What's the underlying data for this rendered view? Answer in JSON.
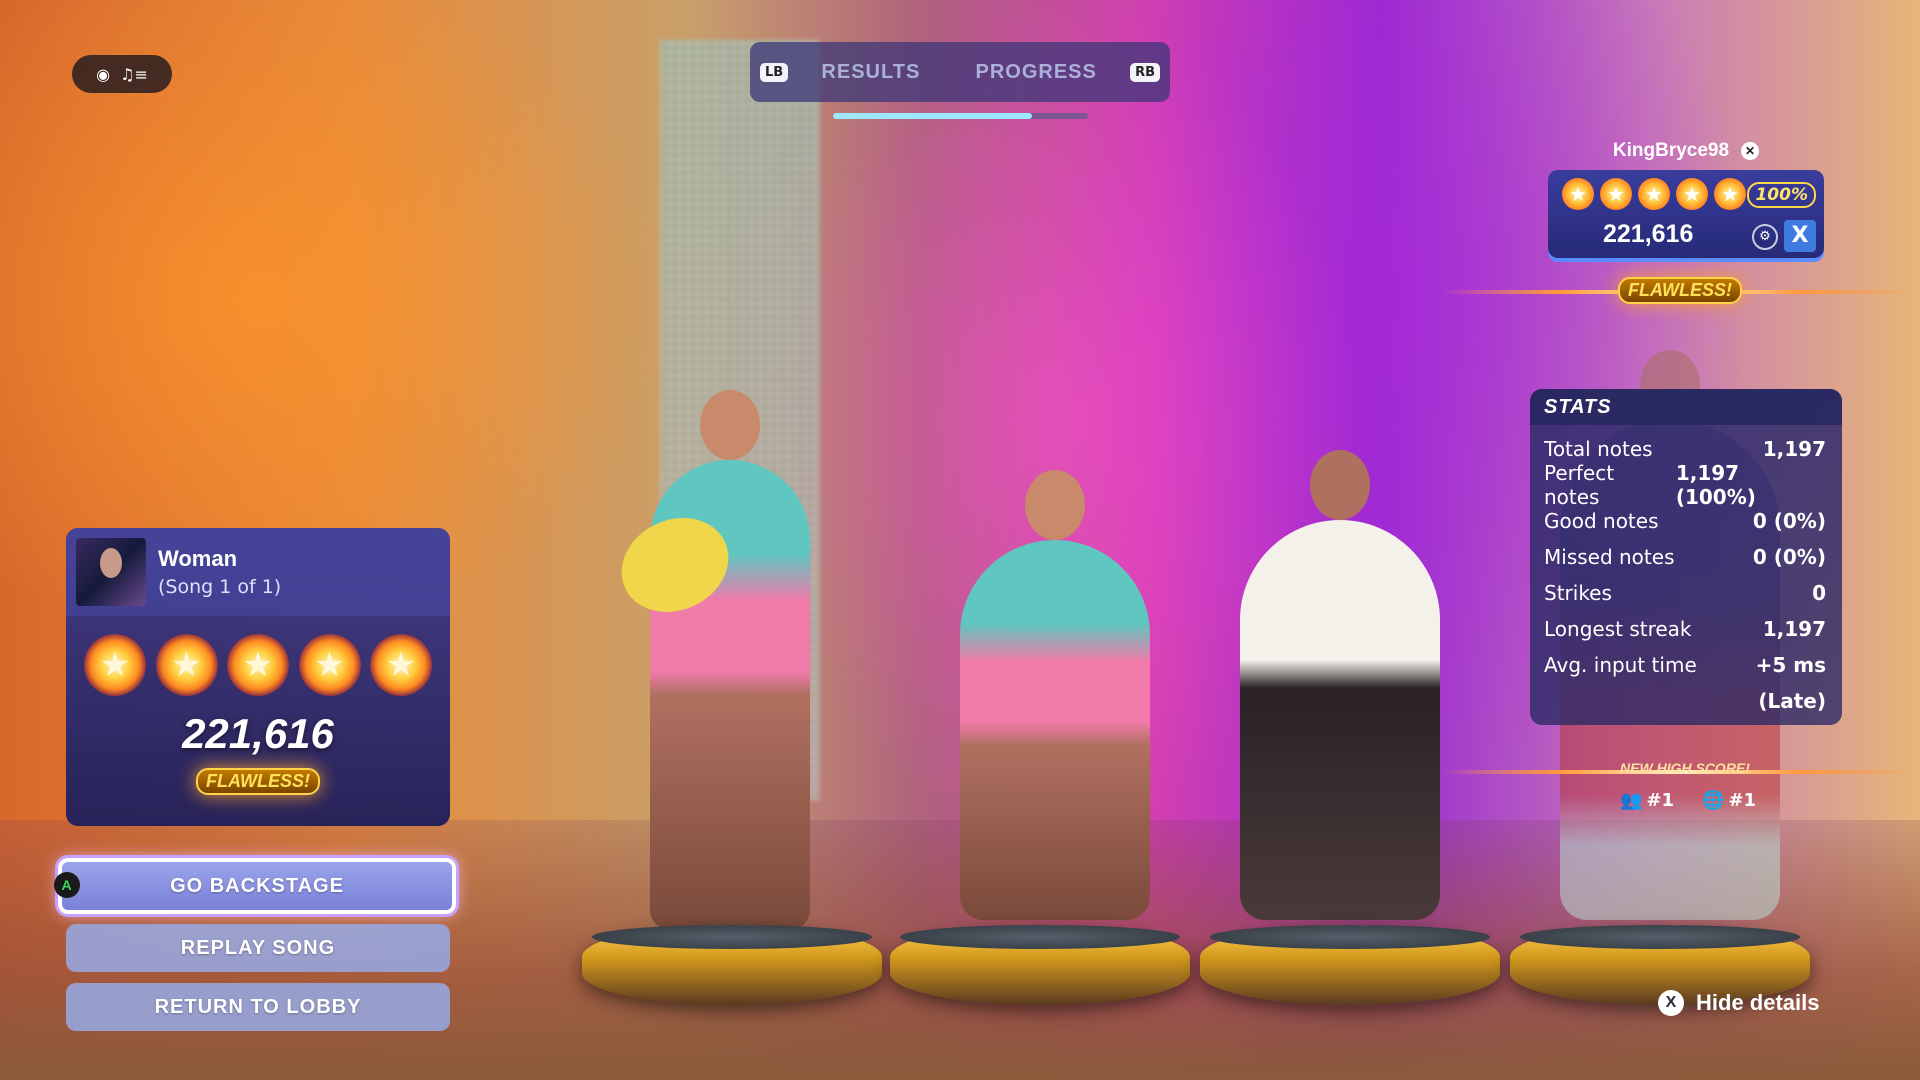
{
  "top_chip": {
    "icons": [
      "party-icon",
      "music-note-list-icon"
    ]
  },
  "tabs": {
    "left_key": "LB",
    "right_key": "RB",
    "items": [
      "RESULTS",
      "PROGRESS"
    ],
    "active_progress": 0.78
  },
  "player": {
    "name": "KingBryce98",
    "platform_icon": "xbox-icon",
    "stars": 5,
    "accuracy": "100%",
    "score": "221,616",
    "instrument_icon": "instrument-icon",
    "button_key": "X",
    "badge": "FLAWLESS!"
  },
  "song": {
    "title": "Woman",
    "subtitle": "(Song 1 of 1)",
    "stars": 5,
    "score": "221,616",
    "badge": "FLAWLESS!"
  },
  "menu": {
    "a_key": "A",
    "go_backstage": "GO BACKSTAGE",
    "replay_song": "REPLAY SONG",
    "return_to_lobby": "RETURN TO LOBBY"
  },
  "stats": {
    "title": "STATS",
    "rows": [
      {
        "label": "Total notes",
        "value": "1,197"
      },
      {
        "label": "Perfect notes",
        "value": "1,197 (100%)"
      },
      {
        "label": "Good notes",
        "value": "0 (0%)"
      },
      {
        "label": "Missed notes",
        "value": "0 (0%)"
      },
      {
        "label": "Strikes",
        "value": "0"
      },
      {
        "label": "Longest streak",
        "value": "1,197"
      },
      {
        "label": "Avg. input time",
        "value": "+5 ms"
      },
      {
        "label": "",
        "value": "(Late)"
      }
    ]
  },
  "high_score": {
    "label": "NEW HIGH SCORE!",
    "friends_rank": "#1",
    "global_rank": "#1"
  },
  "hide_details": {
    "key": "X",
    "label": "Hide details"
  },
  "colors": {
    "accent_gold": "#ffd447",
    "panel": "#2e2f86",
    "x_button": "#3d7be0",
    "a_button_text": "#3ad860"
  }
}
